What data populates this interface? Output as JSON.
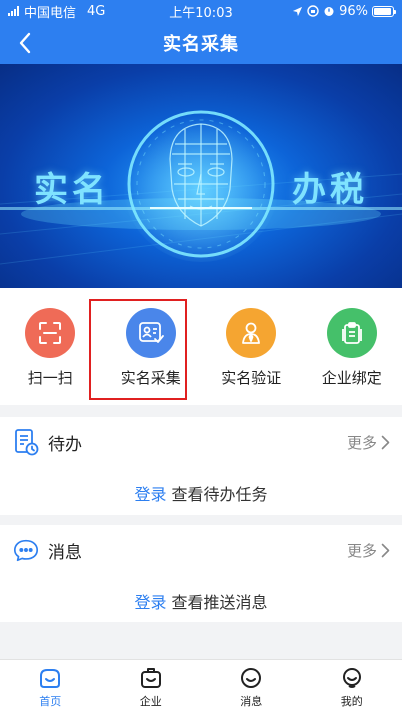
{
  "status_bar": {
    "carrier": "中国电信",
    "network": "4G",
    "time": "上午10:03",
    "battery": "96%",
    "battery_level": 0.96
  },
  "nav": {
    "title": "实名采集",
    "back_icon": "chevron-left-icon"
  },
  "banner": {
    "left_text": "实名",
    "right_text": "办税",
    "page_count": 2,
    "active_page": 2
  },
  "functions": [
    {
      "label": "扫一扫",
      "icon": "scan-icon",
      "color": "#ef6b57"
    },
    {
      "label": "实名采集",
      "icon": "id-card-icon",
      "color": "#4a86ea"
    },
    {
      "label": "实名验证",
      "icon": "person-verify-icon",
      "color": "#f5a531"
    },
    {
      "label": "企业绑定",
      "icon": "clipboard-icon",
      "color": "#45c06a"
    }
  ],
  "todo": {
    "title": "待办",
    "more": "更多",
    "login": "登录",
    "text": "查看待办任务"
  },
  "messages": {
    "title": "消息",
    "more": "更多",
    "login": "登录",
    "text": "查看推送消息"
  },
  "tabs": [
    {
      "label": "首页",
      "icon": "home-icon",
      "active": true
    },
    {
      "label": "企业",
      "icon": "enterprise-icon",
      "active": false
    },
    {
      "label": "消息",
      "icon": "message-icon",
      "active": false
    },
    {
      "label": "我的",
      "icon": "profile-icon",
      "active": false
    }
  ],
  "colors": {
    "primary": "#2d7ff0",
    "highlight_border": "#e02020",
    "banner_text": "#7fe3ff"
  }
}
